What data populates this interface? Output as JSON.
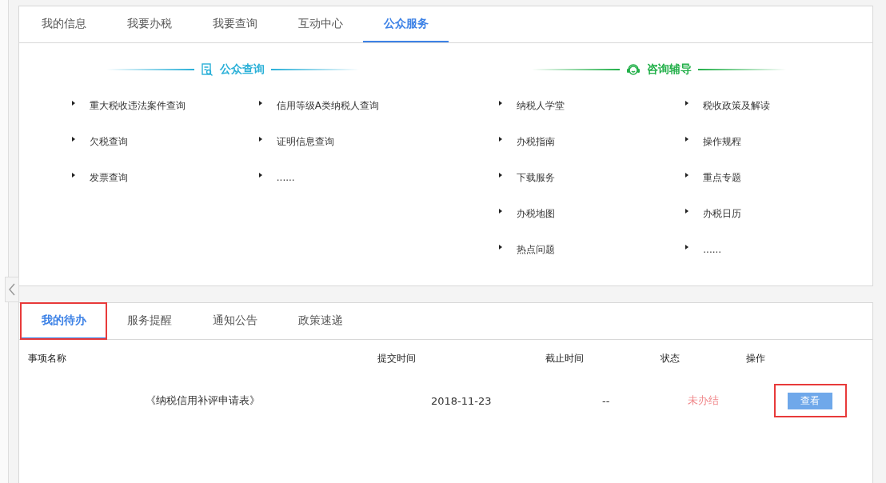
{
  "top_tabs": [
    {
      "label": "我的信息",
      "selected": false
    },
    {
      "label": "我要办税",
      "selected": false
    },
    {
      "label": "我要查询",
      "selected": false
    },
    {
      "label": "互动中心",
      "selected": false
    },
    {
      "label": "公众服务",
      "selected": true
    }
  ],
  "sections": [
    {
      "kind": "query",
      "title": "公众查询",
      "color": "#2ab0d8",
      "columns": [
        [
          "重大税收违法案件查询",
          "欠税查询",
          "发票查询"
        ],
        [
          "信用等级A类纳税人查询",
          "证明信息查询",
          "......"
        ]
      ]
    },
    {
      "kind": "consult",
      "title": "咨询辅导",
      "color": "#23b04a",
      "columns": [
        [
          "纳税人学堂",
          "办税指南",
          "下载服务",
          "办税地图",
          "热点问题"
        ],
        [
          "税收政策及解读",
          "操作规程",
          "重点专题",
          "办税日历",
          "......"
        ]
      ]
    }
  ],
  "bottom_tabs": [
    {
      "label": "我的待办",
      "selected": true,
      "highlighted": true
    },
    {
      "label": "服务提醒",
      "selected": false,
      "highlighted": false
    },
    {
      "label": "通知公告",
      "selected": false,
      "highlighted": false
    },
    {
      "label": "政策速递",
      "selected": false,
      "highlighted": false
    }
  ],
  "table": {
    "columns": [
      "事项名称",
      "提交时间",
      "截止时间",
      "状态",
      "操作"
    ],
    "rows": [
      {
        "name": "《纳税信用补评申请表》",
        "submitted": "2018-11-23",
        "deadline": "--",
        "status": "未办结",
        "action": "查看",
        "action_highlighted": true
      }
    ]
  }
}
